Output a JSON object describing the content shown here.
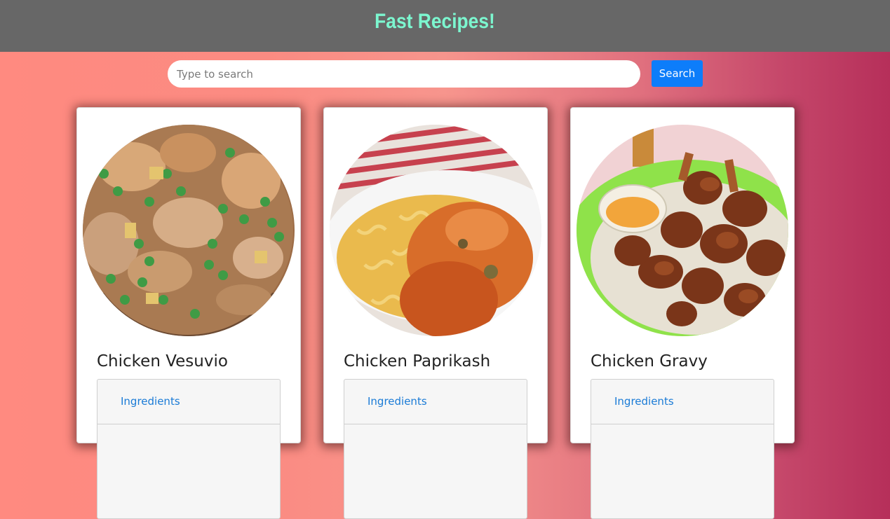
{
  "header": {
    "title": "Fast Recipes!"
  },
  "search": {
    "placeholder": "Type to search",
    "value": "",
    "button_label": "Search"
  },
  "recipes": [
    {
      "title": "Chicken Vesuvio",
      "link_label": "Ingredients"
    },
    {
      "title": "Chicken Paprikash",
      "link_label": "Ingredients"
    },
    {
      "title": "Chicken Gravy",
      "link_label": "Ingredients"
    }
  ],
  "colors": {
    "header_bg": "#676767",
    "title": "#7cf6cf",
    "button": "#0d7dfa",
    "link": "#1a7bd6"
  }
}
